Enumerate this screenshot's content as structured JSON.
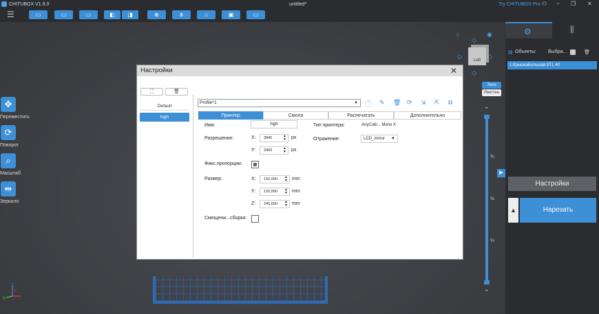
{
  "app": {
    "name": "CHITUBOX V1.9.0",
    "document": "untitled*",
    "try_pro": "Try CHITUBOX Pro"
  },
  "window_controls": {
    "user_icon": "user-icon",
    "minimize": "−",
    "restore": "❐",
    "close": "✕"
  },
  "left_tools": [
    {
      "label": "Переместить",
      "icon": "move-icon",
      "glyph": "✥"
    },
    {
      "label": "Поворот",
      "icon": "rotate-icon",
      "glyph": "⟳"
    },
    {
      "label": "Масштаб",
      "icon": "scale-icon",
      "glyph": "⌕"
    },
    {
      "label": "Зеркало",
      "icon": "mirror-icon",
      "glyph": "⇹"
    }
  ],
  "view": {
    "cube_label": "Left",
    "body_btn": "Тело",
    "xray_btn": "Рентген"
  },
  "slider_labels": [
    "¾",
    "½",
    "¼"
  ],
  "axes": {
    "z": "Z",
    "y": "Y",
    "x": "X"
  },
  "right_panel": {
    "objects_label": "Объекты:",
    "select_label": "Выбра...",
    "object_item": "1.КрышкаБольшая.STL 40",
    "settings_btn": "Настройки",
    "slice_btn": "Нарезать",
    "expand_arrow": "▶",
    "slice_arrow": "▲"
  },
  "dialog": {
    "title": "Настройки",
    "close": "✕",
    "profiles": [
      "Default",
      "high"
    ],
    "selected_profile": "Profile*1",
    "tabs": [
      "Принтер",
      "Смола",
      "Распечатать",
      "Дополнительно"
    ],
    "active_tab": 0,
    "name_label": "Имя:",
    "name_value": "high",
    "resolution_label": "Разрешение:",
    "res_x_label": "X:",
    "res_x": "3840",
    "res_y_label": "У:",
    "res_y": "2400",
    "px": "px",
    "fix_prop_label": "Фикс.пропорции:",
    "size_label": "Размер:",
    "size_x_label": "X:",
    "size_x": "192,000",
    "size_y_label": "У:",
    "size_y": "120,000",
    "size_z_label": "Z:",
    "size_z": "245,000",
    "mm": "mm",
    "offset_label": "Смещени...сборки:",
    "printer_type_label": "Тип принтера:",
    "printer_type_value": "AnyCubi... Mono X",
    "mirror_label": "Отражение:",
    "mirror_value": "LCD_mirror"
  },
  "colors": {
    "accent": "#3d8fd6",
    "panel": "#2a2c30",
    "viewport": "#3b3d41"
  }
}
